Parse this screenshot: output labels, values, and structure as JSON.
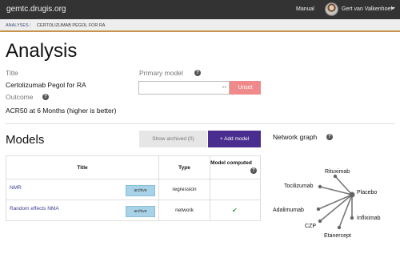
{
  "topbar": {
    "brand": "gemtc.drugis.org",
    "manual_label": "Manual",
    "user_name": "Gert van Valkenhoef",
    "icons": [
      "avatar",
      "chevron-down-icon"
    ]
  },
  "breadcrumb": {
    "items": [
      "ANALYSES",
      "CERTOLIZUMAB PEGOL FOR RA"
    ],
    "separator": "/"
  },
  "analysis": {
    "heading": "Analysis",
    "title_label": "Title",
    "title_value": "Certolizumab Pegol for RA",
    "outcome_label": "Outcome",
    "outcome_value": "ACR50 at 6 Months (higher is better)",
    "primary_model_label": "Primary model",
    "primary_model_value": "--",
    "unset_label": "Unset"
  },
  "models": {
    "heading": "Models",
    "show_archived_label": "Show archived (0)",
    "add_model_label": "+ Add model",
    "columns": [
      "Title",
      "Type",
      "Model computed"
    ],
    "rows": [
      {
        "title": "NMR",
        "archive_label": "archive",
        "type": "regression",
        "computed": false
      },
      {
        "title": "Random effects NMA",
        "archive_label": "archive",
        "type": "network",
        "computed": true
      }
    ]
  },
  "network_graph": {
    "heading": "Network graph",
    "nodes": [
      "Rituximab",
      "Tocilizumab",
      "Placebo",
      "Adalimumab",
      "Infliximab",
      "CZP",
      "Etanercept"
    ],
    "edges": [
      [
        "Placebo",
        "Rituximab"
      ],
      [
        "Placebo",
        "Tocilizumab"
      ],
      [
        "Placebo",
        "Adalimumab"
      ],
      [
        "Placebo",
        "Infliximab"
      ],
      [
        "Placebo",
        "CZP"
      ],
      [
        "Placebo",
        "Etanercept"
      ]
    ]
  },
  "colors": {
    "topbar": "#333333",
    "accent_purple": "#4a2e8f",
    "unset_red": "#f08a8a",
    "archive_blue": "#a8d2e8",
    "breadcrumb_border": "#c7934d",
    "check_green": "#3a9a3a"
  }
}
